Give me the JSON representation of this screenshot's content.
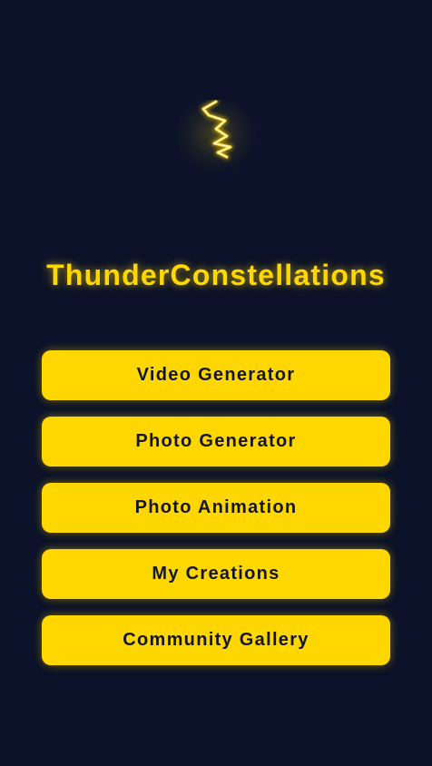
{
  "app": {
    "title": "ThunderConstellations",
    "logo_icon": "lightning-bolt-icon",
    "accent_color": "#ffd700",
    "background_color": "#0b1229",
    "button_text_color": "#14142a"
  },
  "menu": {
    "items": [
      {
        "id": "video-generator",
        "label": "Video Generator"
      },
      {
        "id": "photo-generator",
        "label": "Photo Generator"
      },
      {
        "id": "photo-animation",
        "label": "Photo Animation"
      },
      {
        "id": "my-creations",
        "label": "My Creations"
      },
      {
        "id": "community-gallery",
        "label": "Community Gallery"
      }
    ]
  }
}
